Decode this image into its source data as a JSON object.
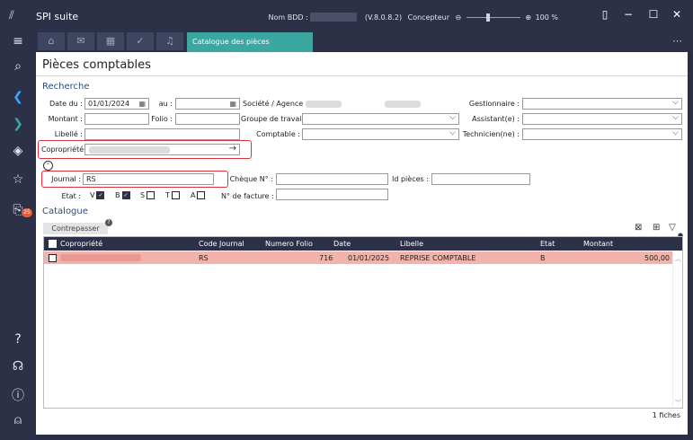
{
  "app": {
    "title": "SPI suite"
  },
  "titlebar": {
    "db_label": "Nom BDD :",
    "version": "(V.8.0.8.2)",
    "user": "Concepteur",
    "zoom": "100 %"
  },
  "tabs": {
    "active_label": "Catalogue des pièces comptables",
    "close": "✕"
  },
  "sidebar": {
    "badge": "25"
  },
  "page": {
    "title": "Pièces comptables",
    "section_search": "Recherche",
    "section_catalog": "Catalogue"
  },
  "form": {
    "date_du_label": "Date du :",
    "date_du_value": "01/01/2024",
    "au_label": "au :",
    "au_value": "",
    "societe_label": "Société / Agence :",
    "gestionnaire_label": "Gestionnaire :",
    "montant_label": "Montant :",
    "folio_label": "Folio :",
    "groupe_label": "Groupe de travail :",
    "assistant_label": "Assistant(e) :",
    "libelle_label": "Libellé :",
    "comptable_label": "Comptable :",
    "technicien_label": "Technicien(ne) :",
    "copropriete_label": "Copropriété :",
    "journal_label": "Journal :",
    "journal_value": "RS",
    "cheque_label": "Chèque N° :",
    "idpieces_label": "Id pièces :",
    "etat_label": "Etat :",
    "etat_options": [
      {
        "label": "V",
        "checked": true
      },
      {
        "label": "B",
        "checked": true
      },
      {
        "label": "S",
        "checked": false
      },
      {
        "label": "T",
        "checked": false
      },
      {
        "label": "A",
        "checked": false
      }
    ],
    "facture_label": "N° de facture :"
  },
  "catalog": {
    "contrepasser_label": "Contrepasser",
    "columns": [
      "Copropriété",
      "Code Journal",
      "Numero Folio",
      "Date",
      "Libelle",
      "Etat",
      "Montant"
    ],
    "rows": [
      {
        "code_journal": "RS",
        "folio": "716",
        "date": "01/01/2025",
        "libelle": "REPRISE COMPTABLE",
        "etat": "B",
        "montant": "500,00"
      }
    ],
    "count": "1 fiches"
  },
  "colors": {
    "accent": "#3aa7a0",
    "sidebar": "#2c3147",
    "row_highlight": "#f2b3ad",
    "highlight_border": "#d9333f"
  }
}
